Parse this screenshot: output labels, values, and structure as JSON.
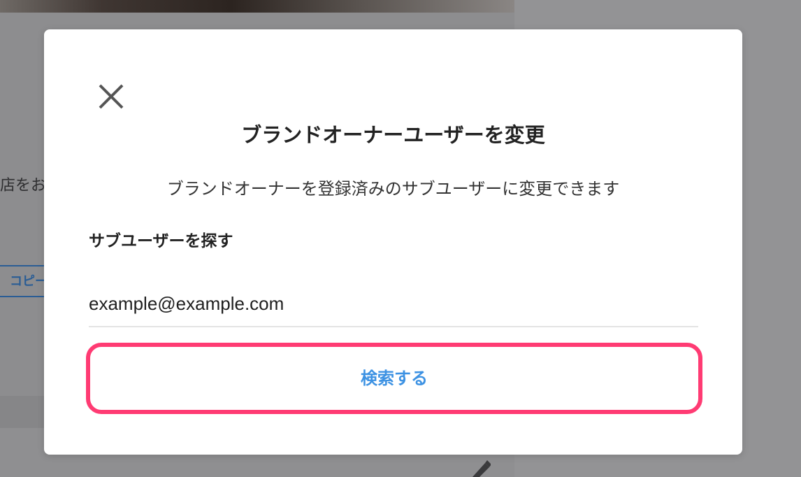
{
  "background": {
    "partial_text": "店をお",
    "copy_button_label": "コピー"
  },
  "modal": {
    "close_icon": "close-icon",
    "title": "ブランドオーナーユーザーを変更",
    "description": "ブランドオーナーを登録済みのサブユーザーに変更できます",
    "search_section_label": "サブユーザーを探す",
    "email_value": "example@example.com",
    "search_button_label": "検索する"
  },
  "colors": {
    "overlay": "#8f8f91",
    "highlight": "#ff3b73",
    "accent": "#3d92e3"
  }
}
